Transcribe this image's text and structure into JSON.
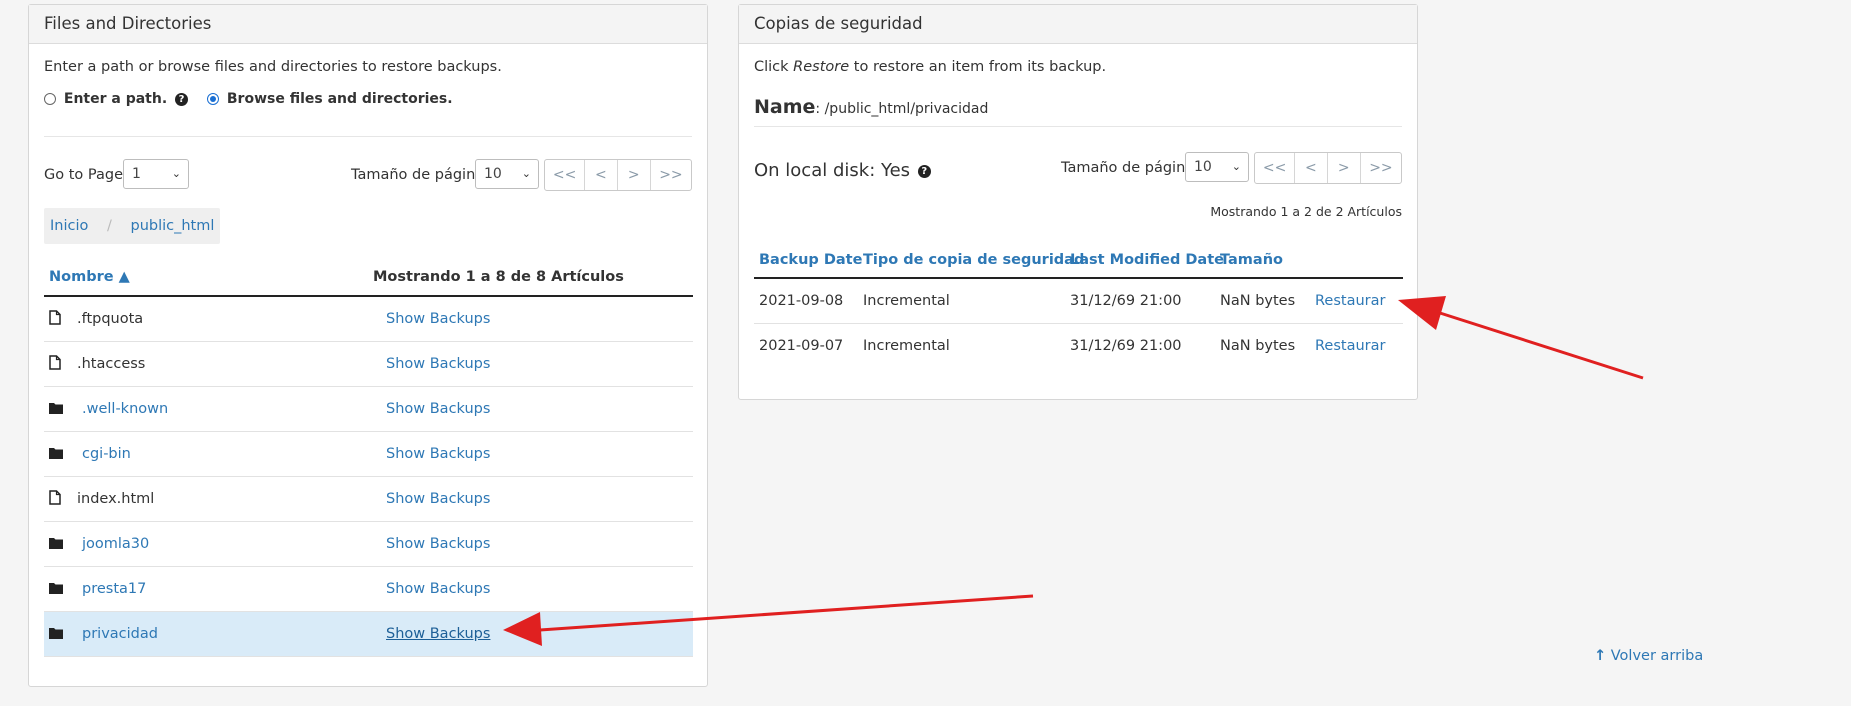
{
  "files_panel": {
    "title": "Files and Directories",
    "instructions": "Enter a path or browse files and directories to restore backups.",
    "option_path": "Enter a path.",
    "option_browse": "Browse files and directories.",
    "goto_label": "Go to Page:",
    "goto_value": "1",
    "page_size_label": "Tamaño de página",
    "page_size_value": "10",
    "pager": [
      "<<",
      "<",
      ">",
      ">>"
    ],
    "breadcrumb": [
      "Inicio",
      "public_html"
    ],
    "breadcrumb_sep": "/",
    "col_name": "Nombre ▲",
    "col_count": "Mostrando 1 a 8 de 8 Artículos",
    "rows": [
      {
        "name": ".ftpquota",
        "type": "file",
        "action": "Show Backups"
      },
      {
        "name": ".htaccess",
        "type": "file",
        "action": "Show Backups"
      },
      {
        "name": ".well-known",
        "type": "folder",
        "action": "Show Backups"
      },
      {
        "name": "cgi-bin",
        "type": "folder",
        "action": "Show Backups"
      },
      {
        "name": "index.html",
        "type": "file",
        "action": "Show Backups"
      },
      {
        "name": "joomla30",
        "type": "folder",
        "action": "Show Backups"
      },
      {
        "name": "presta17",
        "type": "folder",
        "action": "Show Backups"
      },
      {
        "name": "privacidad",
        "type": "folder",
        "action": "Show Backups"
      }
    ]
  },
  "backups_panel": {
    "title": "Copias de seguridad",
    "instr_prefix": "Click ",
    "instr_em": "Restore",
    "instr_suffix": " to restore an item from its backup.",
    "name_label": "Name",
    "name_value": ": /public_html/privacidad",
    "local_disk": "On local disk: Yes",
    "page_size_label": "Tamaño de página",
    "page_size_value": "10",
    "pager": [
      "<<",
      "<",
      ">",
      ">>"
    ],
    "showing": "Mostrando 1 a 2 de 2 Artículos",
    "columns": [
      "Backup Date",
      "Tipo de copia de seguridad",
      "Last Modified Date",
      "Tamaño"
    ],
    "rows": [
      {
        "date": "2021-09-08",
        "type": "Incremental",
        "modified": "31/12/69 21:00",
        "size": "NaN bytes",
        "action": "Restaurar"
      },
      {
        "date": "2021-09-07",
        "type": "Incremental",
        "modified": "31/12/69 21:00",
        "size": "NaN bytes",
        "action": "Restaurar"
      }
    ]
  },
  "back_to_top": "Volver arriba",
  "colors": {
    "link": "#2e78b5",
    "annotation_arrow": "#e02020",
    "active_row": "#d9ebf8"
  }
}
